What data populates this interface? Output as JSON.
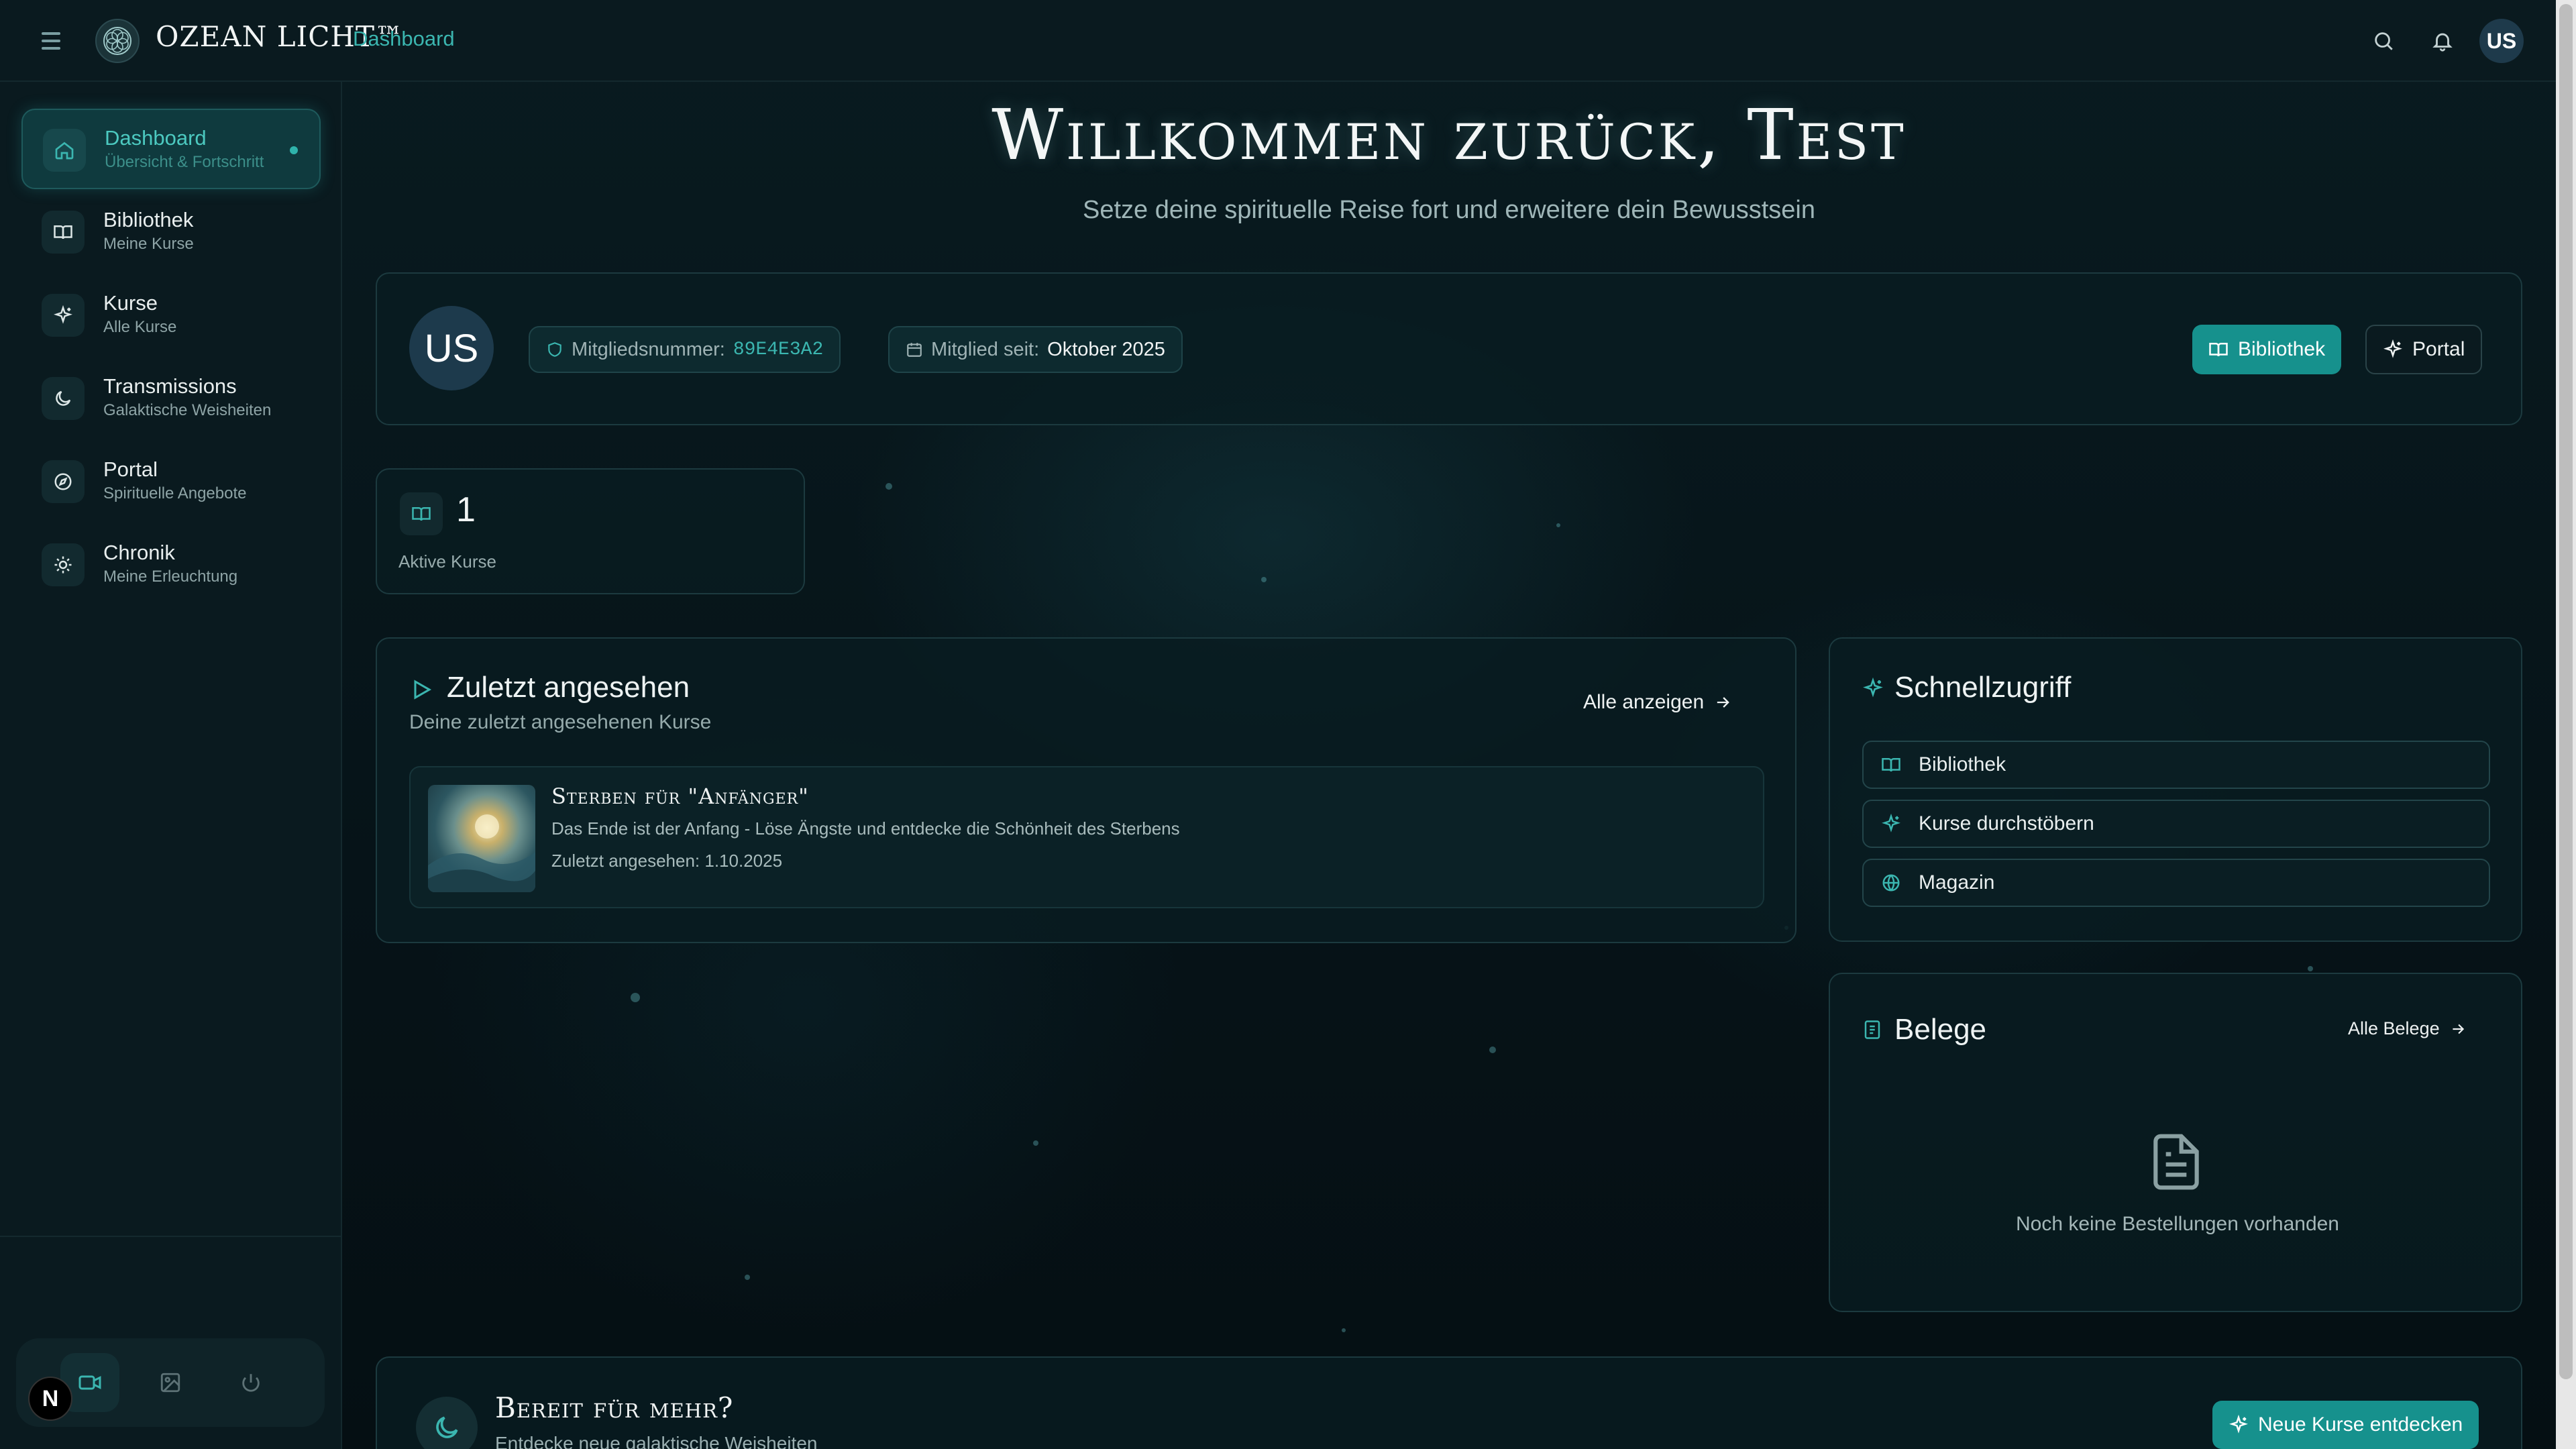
{
  "app": {
    "brand": "OZEAN LICHT™",
    "breadcrumb": "Dashboard"
  },
  "colors": {
    "accent": "#16918d",
    "accent_text": "#3bb6b0",
    "background": "#07151a",
    "panel": "#0a1a1f"
  },
  "topbar": {
    "avatar_initials": "US",
    "icons": [
      "menu-icon",
      "search-icon",
      "bell-icon"
    ]
  },
  "sidebar": {
    "items": [
      {
        "title": "Dashboard",
        "subtitle": "Übersicht & Fortschritt",
        "icon": "home-icon",
        "active": true
      },
      {
        "title": "Bibliothek",
        "subtitle": "Meine Kurse",
        "icon": "book-icon",
        "active": false
      },
      {
        "title": "Kurse",
        "subtitle": "Alle Kurse",
        "icon": "sparkles-icon",
        "active": false
      },
      {
        "title": "Transmissions",
        "subtitle": "Galaktische Weisheiten",
        "icon": "moon-icon",
        "active": false
      },
      {
        "title": "Portal",
        "subtitle": "Spirituelle Angebote",
        "icon": "compass-icon",
        "active": false
      },
      {
        "title": "Chronik",
        "subtitle": "Meine Erleuchtung",
        "icon": "sun-icon",
        "active": false
      }
    ],
    "tools": [
      "video-icon",
      "image-icon",
      "power-icon"
    ],
    "badge": "N"
  },
  "welcome": {
    "title": "Willkommen zurück, Test",
    "subtitle": "Setze deine spirituelle Reise fort und erweitere dein Bewusstsein"
  },
  "profile": {
    "initials": "US",
    "member_number_label": "Mitgliedsnummer:",
    "member_number": "89E4E3A2",
    "member_since_label": "Mitglied seit:",
    "member_since": "Oktober 2025",
    "library_button": "Bibliothek",
    "portal_button": "Portal"
  },
  "stats": {
    "active_courses_value": "1",
    "active_courses_label": "Aktive Kurse"
  },
  "recent": {
    "title": "Zuletzt angesehen",
    "subtitle": "Deine zuletzt angesehenen Kurse",
    "view_all": "Alle anzeigen",
    "course": {
      "title": "Sterben für \"Anfänger\"",
      "description": "Das Ende ist der Anfang - Löse Ängste und entdecke die Schönheit des Sterbens",
      "last_viewed": "Zuletzt angesehen: 1.10.2025"
    }
  },
  "quick_access": {
    "title": "Schnellzugriff",
    "items": [
      {
        "label": "Bibliothek",
        "icon": "book-icon"
      },
      {
        "label": "Kurse durchstöbern",
        "icon": "sparkles-icon"
      },
      {
        "label": "Magazin",
        "icon": "globe-icon"
      }
    ]
  },
  "receipts": {
    "title": "Belege",
    "view_all": "Alle Belege",
    "empty": "Noch keine Bestellungen vorhanden"
  },
  "banner": {
    "title": "Bereit für mehr?",
    "subtitle": "Entdecke neue galaktische Weisheiten",
    "button": "Neue Kurse entdecken"
  }
}
